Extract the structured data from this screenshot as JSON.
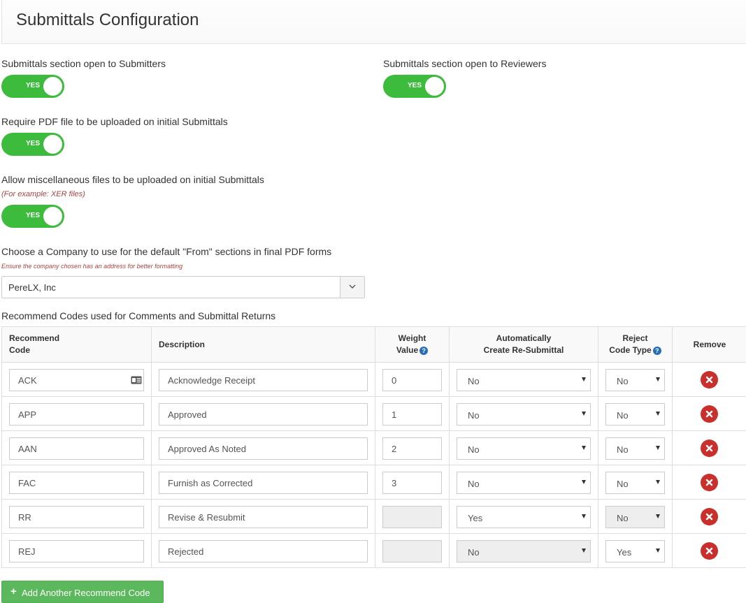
{
  "page": {
    "title": "Submittals Configuration"
  },
  "settings": {
    "open_to_submitters": {
      "label": "Submittals section open to Submitters",
      "value": "YES"
    },
    "open_to_reviewers": {
      "label": "Submittals section open to Reviewers",
      "value": "YES"
    },
    "require_pdf": {
      "label": "Require PDF file to be uploaded on initial Submittals",
      "value": "YES"
    },
    "allow_misc": {
      "label": "Allow miscellaneous files to be uploaded on initial Submittals",
      "hint": "(For example: XER files)",
      "value": "YES"
    },
    "company": {
      "label": "Choose a Company to use for the default \"From\" sections in final PDF forms",
      "hint": "Ensure the company chosen has an address for better formatting",
      "value": "PereLX, Inc"
    }
  },
  "codes": {
    "section_label": "Recommend Codes used for Comments and Submittal Returns",
    "headers": {
      "code_line1": "Recommend",
      "code_line2": "Code",
      "description": "Description",
      "weight_line1": "Weight",
      "weight_line2": "Value",
      "auto_line1": "Automatically",
      "auto_line2": "Create Re-Submittal",
      "reject_line1": "Reject",
      "reject_line2": "Code Type",
      "remove": "Remove"
    },
    "rows": [
      {
        "code": "ACK",
        "description": "Acknowledge Receipt",
        "weight": "0",
        "auto": "No",
        "reject": "No"
      },
      {
        "code": "APP",
        "description": "Approved",
        "weight": "1",
        "auto": "No",
        "reject": "No"
      },
      {
        "code": "AAN",
        "description": "Approved As Noted",
        "weight": "2",
        "auto": "No",
        "reject": "No"
      },
      {
        "code": "FAC",
        "description": "Furnish as Corrected",
        "weight": "3",
        "auto": "No",
        "reject": "No"
      },
      {
        "code": "RR",
        "description": "Revise & Resubmit",
        "weight": "",
        "auto": "Yes",
        "reject": "No"
      },
      {
        "code": "REJ",
        "description": "Rejected",
        "weight": "",
        "auto": "No",
        "reject": "Yes"
      }
    ],
    "add_button": "Add Another Recommend Code"
  },
  "colors": {
    "toggle_on": "#3dbb3d",
    "remove": "#c9302c",
    "add_button": "#5cb85c",
    "help": "#2a6db5"
  },
  "icons": {
    "help": "question-circle-icon",
    "remove": "times-circle-icon",
    "plus": "plus-icon",
    "card": "contact-card-icon",
    "caret": "chevron-down-icon"
  }
}
